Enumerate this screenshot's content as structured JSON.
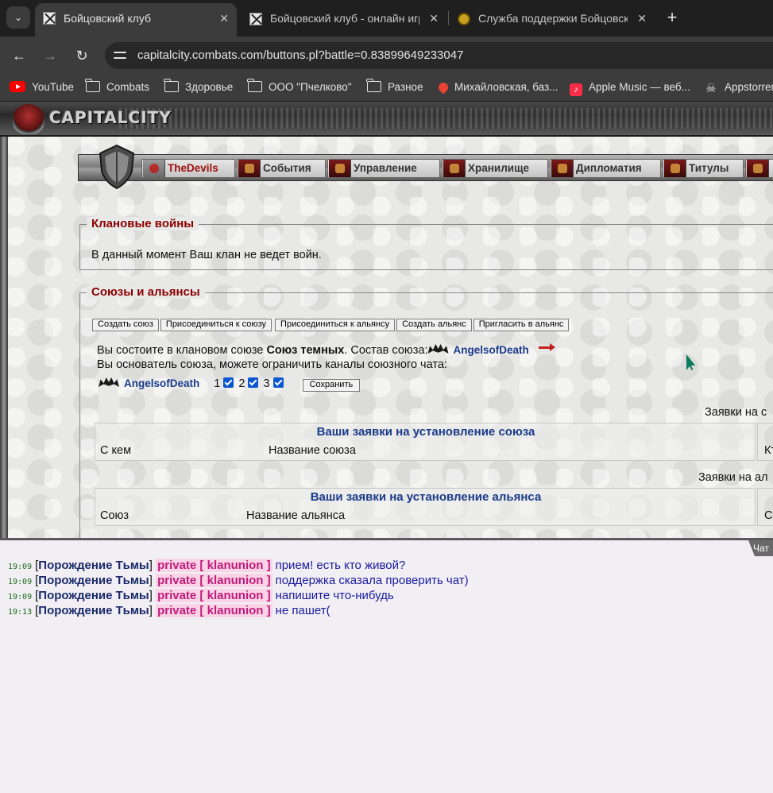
{
  "browser": {
    "tabs": [
      {
        "title": "Бойцовский клуб",
        "active": true
      },
      {
        "title": "Бойцовский клуб - онлайн игр",
        "active": false
      },
      {
        "title": "Служба поддержки Бойцовско",
        "active": false
      }
    ],
    "url": "capitalcity.combats.com/buttons.pl?battle=0.83899649233047",
    "bookmarks": [
      "YouTube",
      "Combats",
      "Здоровье",
      "ООО \"Пчелково\"",
      "Разное",
      "Михайловская, баз...",
      "Apple Music — веб...",
      "Appstorrent"
    ]
  },
  "site": {
    "logo_text": "CAPITALCITY"
  },
  "clan_menu": {
    "items": [
      "TheDevils",
      "События",
      "Управление",
      "Хранилище",
      "Дипломатия",
      "Титулы"
    ]
  },
  "wars": {
    "legend": "Клановые войны",
    "text": "В данный момент Ваш клан не ведет войн."
  },
  "alliances": {
    "legend": "Союзы и альянсы",
    "buttons": [
      "Создать союз",
      "Присоединиться к союзу",
      "Присоединиться к альянсу",
      "Создать альянс",
      "Пригласить в альянс"
    ],
    "membership_prefix": "Вы состоите в клановом союзе ",
    "union_name": "Союз темных",
    "membership_suffix": ". Состав союза:",
    "member_clan": "AngelsofDeath",
    "founder_text": "Вы основатель союза, можете ограничить каналы союзного чата:",
    "channel_clan": "AngelsofDeath",
    "channels": [
      "1",
      "2",
      "3"
    ],
    "save_label": "Сохранить",
    "requests_union_right": "Заявки на с",
    "union_table": {
      "title": "Ваши заявки на установление союза",
      "col1": "С кем",
      "col2": "Название союза",
      "right_col": "Кт"
    },
    "requests_alliance_right": "Заявки на ал",
    "alliance_table": {
      "title": "Ваши заявки на установление альянса",
      "col1": "Союз",
      "col2": "Название альянса",
      "right_col": "Со"
    }
  },
  "chat": {
    "tab_label": "Чат",
    "lines": [
      {
        "time": "19:09",
        "nick": "Порождение Тьмы",
        "channel": "private [ klanunion ]",
        "text": "прием! есть кто живой?"
      },
      {
        "time": "19:09",
        "nick": "Порождение Тьмы",
        "channel": "private [ klanunion ]",
        "text": "поддержка сказала проверить чат)"
      },
      {
        "time": "19:09",
        "nick": "Порождение Тьмы",
        "channel": "private [ klanunion ]",
        "text": "напишите что-нибудь"
      },
      {
        "time": "19:13",
        "nick": "Порождение Тьмы",
        "channel": "private [ klanunion ]",
        "text": "не пашет("
      }
    ]
  }
}
